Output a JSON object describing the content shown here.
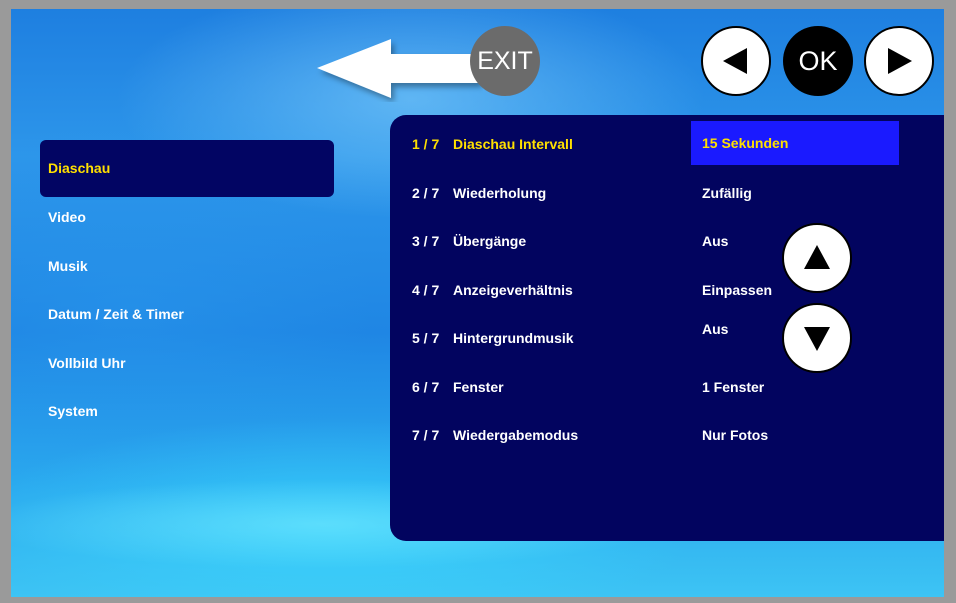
{
  "header": {
    "exit_label": "EXIT",
    "ok_label": "OK"
  },
  "sidebar": {
    "items": [
      {
        "label": "Diaschau",
        "selected": true
      },
      {
        "label": "Video"
      },
      {
        "label": "Musik"
      },
      {
        "label": "Datum / Zeit & Timer"
      },
      {
        "label": "Vollbild Uhr"
      },
      {
        "label": "System"
      }
    ]
  },
  "settings": {
    "rows": [
      {
        "index": "1 / 7",
        "name": "Diaschau Intervall",
        "value": "15 Sekunden",
        "selected": true
      },
      {
        "index": "2 / 7",
        "name": "Wiederholung",
        "value": "Zufällig"
      },
      {
        "index": "3 / 7",
        "name": "Übergänge",
        "value": "Aus"
      },
      {
        "index": "4 / 7",
        "name": "Anzeigeverhältnis",
        "value": "Einpassen"
      },
      {
        "index": "5 / 7",
        "name": "Hintergrundmusik",
        "value": "Aus"
      },
      {
        "index": "6 / 7",
        "name": "Fenster",
        "value": "1 Fenster"
      },
      {
        "index": "7 / 7",
        "name": "Wiedergabemodus",
        "value": "Nur Fotos"
      }
    ]
  },
  "icons": {
    "back_arrow": "left-arrow-icon",
    "prev": "triangle-left-icon",
    "next": "triangle-right-icon",
    "up": "triangle-up-icon",
    "down": "triangle-down-icon"
  },
  "colors": {
    "panel": "#02045f",
    "highlight": "#1a1aff",
    "selected_text": "#ffe000",
    "exit_button": "#6b6b6b"
  }
}
